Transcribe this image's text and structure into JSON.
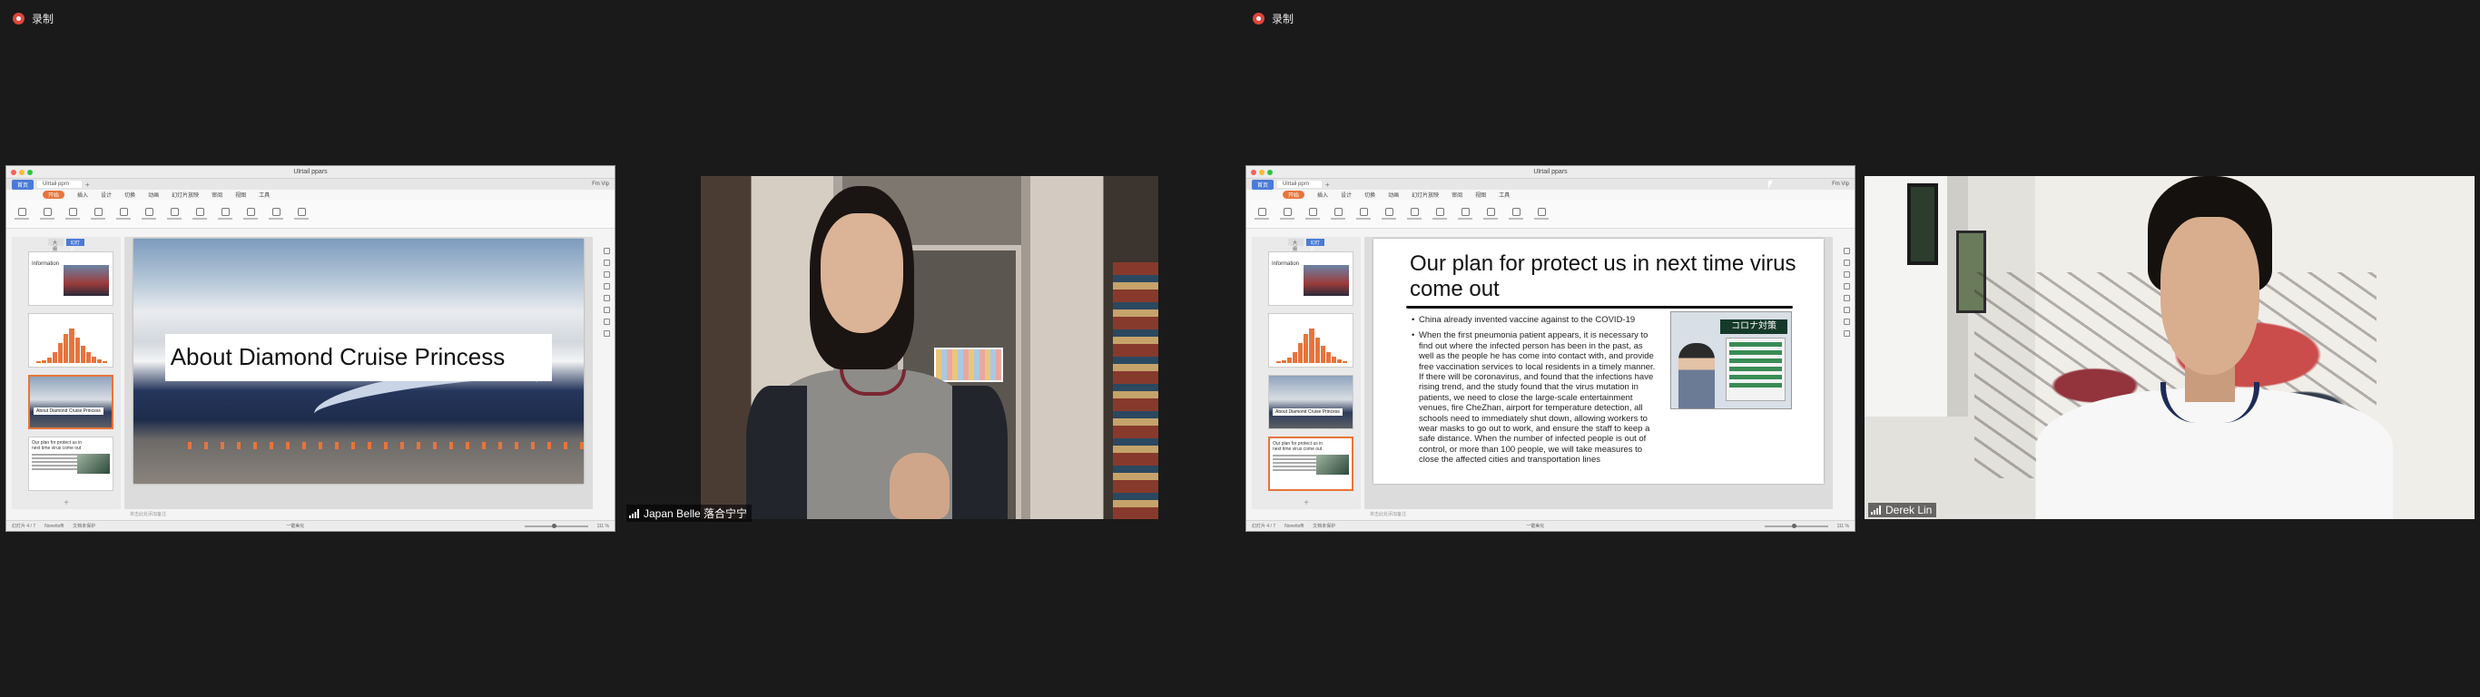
{
  "recording": {
    "label": "录制"
  },
  "shared_screens": [
    {
      "window_title": "Ulrtail ppars",
      "home_tab": "首页",
      "doc_tab": "Ulrtail pprn",
      "account": "Fm Vip",
      "menus": [
        "开始",
        "插入",
        "设计",
        "切换",
        "动画",
        "幻灯片放映",
        "审阅",
        "视图",
        "工具"
      ],
      "thumb_tabs": [
        "大纲",
        "幻灯片"
      ],
      "thumbnails": [
        {
          "num": "1",
          "text": "Information"
        },
        {
          "num": "2",
          "text": ""
        },
        {
          "num": "3",
          "text": "About Diamond Cruise Princess"
        },
        {
          "num": "4",
          "text": "Our plan for protect us in next time virus come out"
        }
      ],
      "status_left": "幻灯片 4 / 7",
      "status_theme": "Noneltoffl",
      "status_protect": "文档未保护",
      "status_beautify": "一键美化",
      "zoom": "111 %",
      "notes_hint": "单击此处添加备注",
      "slide_title": "About Diamond Cruise Princess"
    },
    {
      "window_title": "Ulrtail ppars",
      "home_tab": "首页",
      "doc_tab": "Ulrtail pprn",
      "account": "Fm Vip",
      "menus": [
        "开始",
        "插入",
        "设计",
        "切换",
        "动画",
        "幻灯片放映",
        "审阅",
        "视图",
        "工具"
      ],
      "thumb_tabs": [
        "大纲",
        "幻灯片"
      ],
      "thumbnails": [
        {
          "num": "1",
          "text": "Information"
        },
        {
          "num": "2",
          "text": ""
        },
        {
          "num": "3",
          "text": "About Diamond Cruise Princess"
        },
        {
          "num": "4",
          "text": "Our plan for protect us in next time virus come out"
        }
      ],
      "status_left": "幻灯片 4 / 7",
      "status_theme": "Noneltoffl",
      "status_protect": "文档未保护",
      "status_beautify": "一键美化",
      "zoom": "111 %",
      "notes_hint": "单击此处添加备注",
      "slide_title": "Our plan for protect us in next time virus come out",
      "bullets": [
        "China already invented vaccine against to the COVID-19",
        "When the first pneumonia patient appears, it is necessary to find out where the infected person has been in the past, as well as the people he has come into contact with, and provide free vaccination services to local residents in a timely manner. If there will be coronavirus, and found that the infections have rising trend, and the study found that the virus mutation in patients, we need to close the large-scale entertainment venues, fire CheZhan, airport for temperature detection, all schools need to immediately shut down, allowing workers to wear masks to go out to work, and ensure the staff to keep a safe distance. When the number of infected people is out of control, or more than 100 people, we will take measures to close the affected cities and transportation lines"
      ],
      "photo_banner": "コロナ対策"
    }
  ],
  "participants": [
    {
      "name": "Japan Belle 落合宁宁"
    },
    {
      "name": "Derek Lin"
    }
  ],
  "colors": {
    "accent": "#e8743b",
    "record": "#e0453a",
    "background": "#1a1a1a"
  }
}
